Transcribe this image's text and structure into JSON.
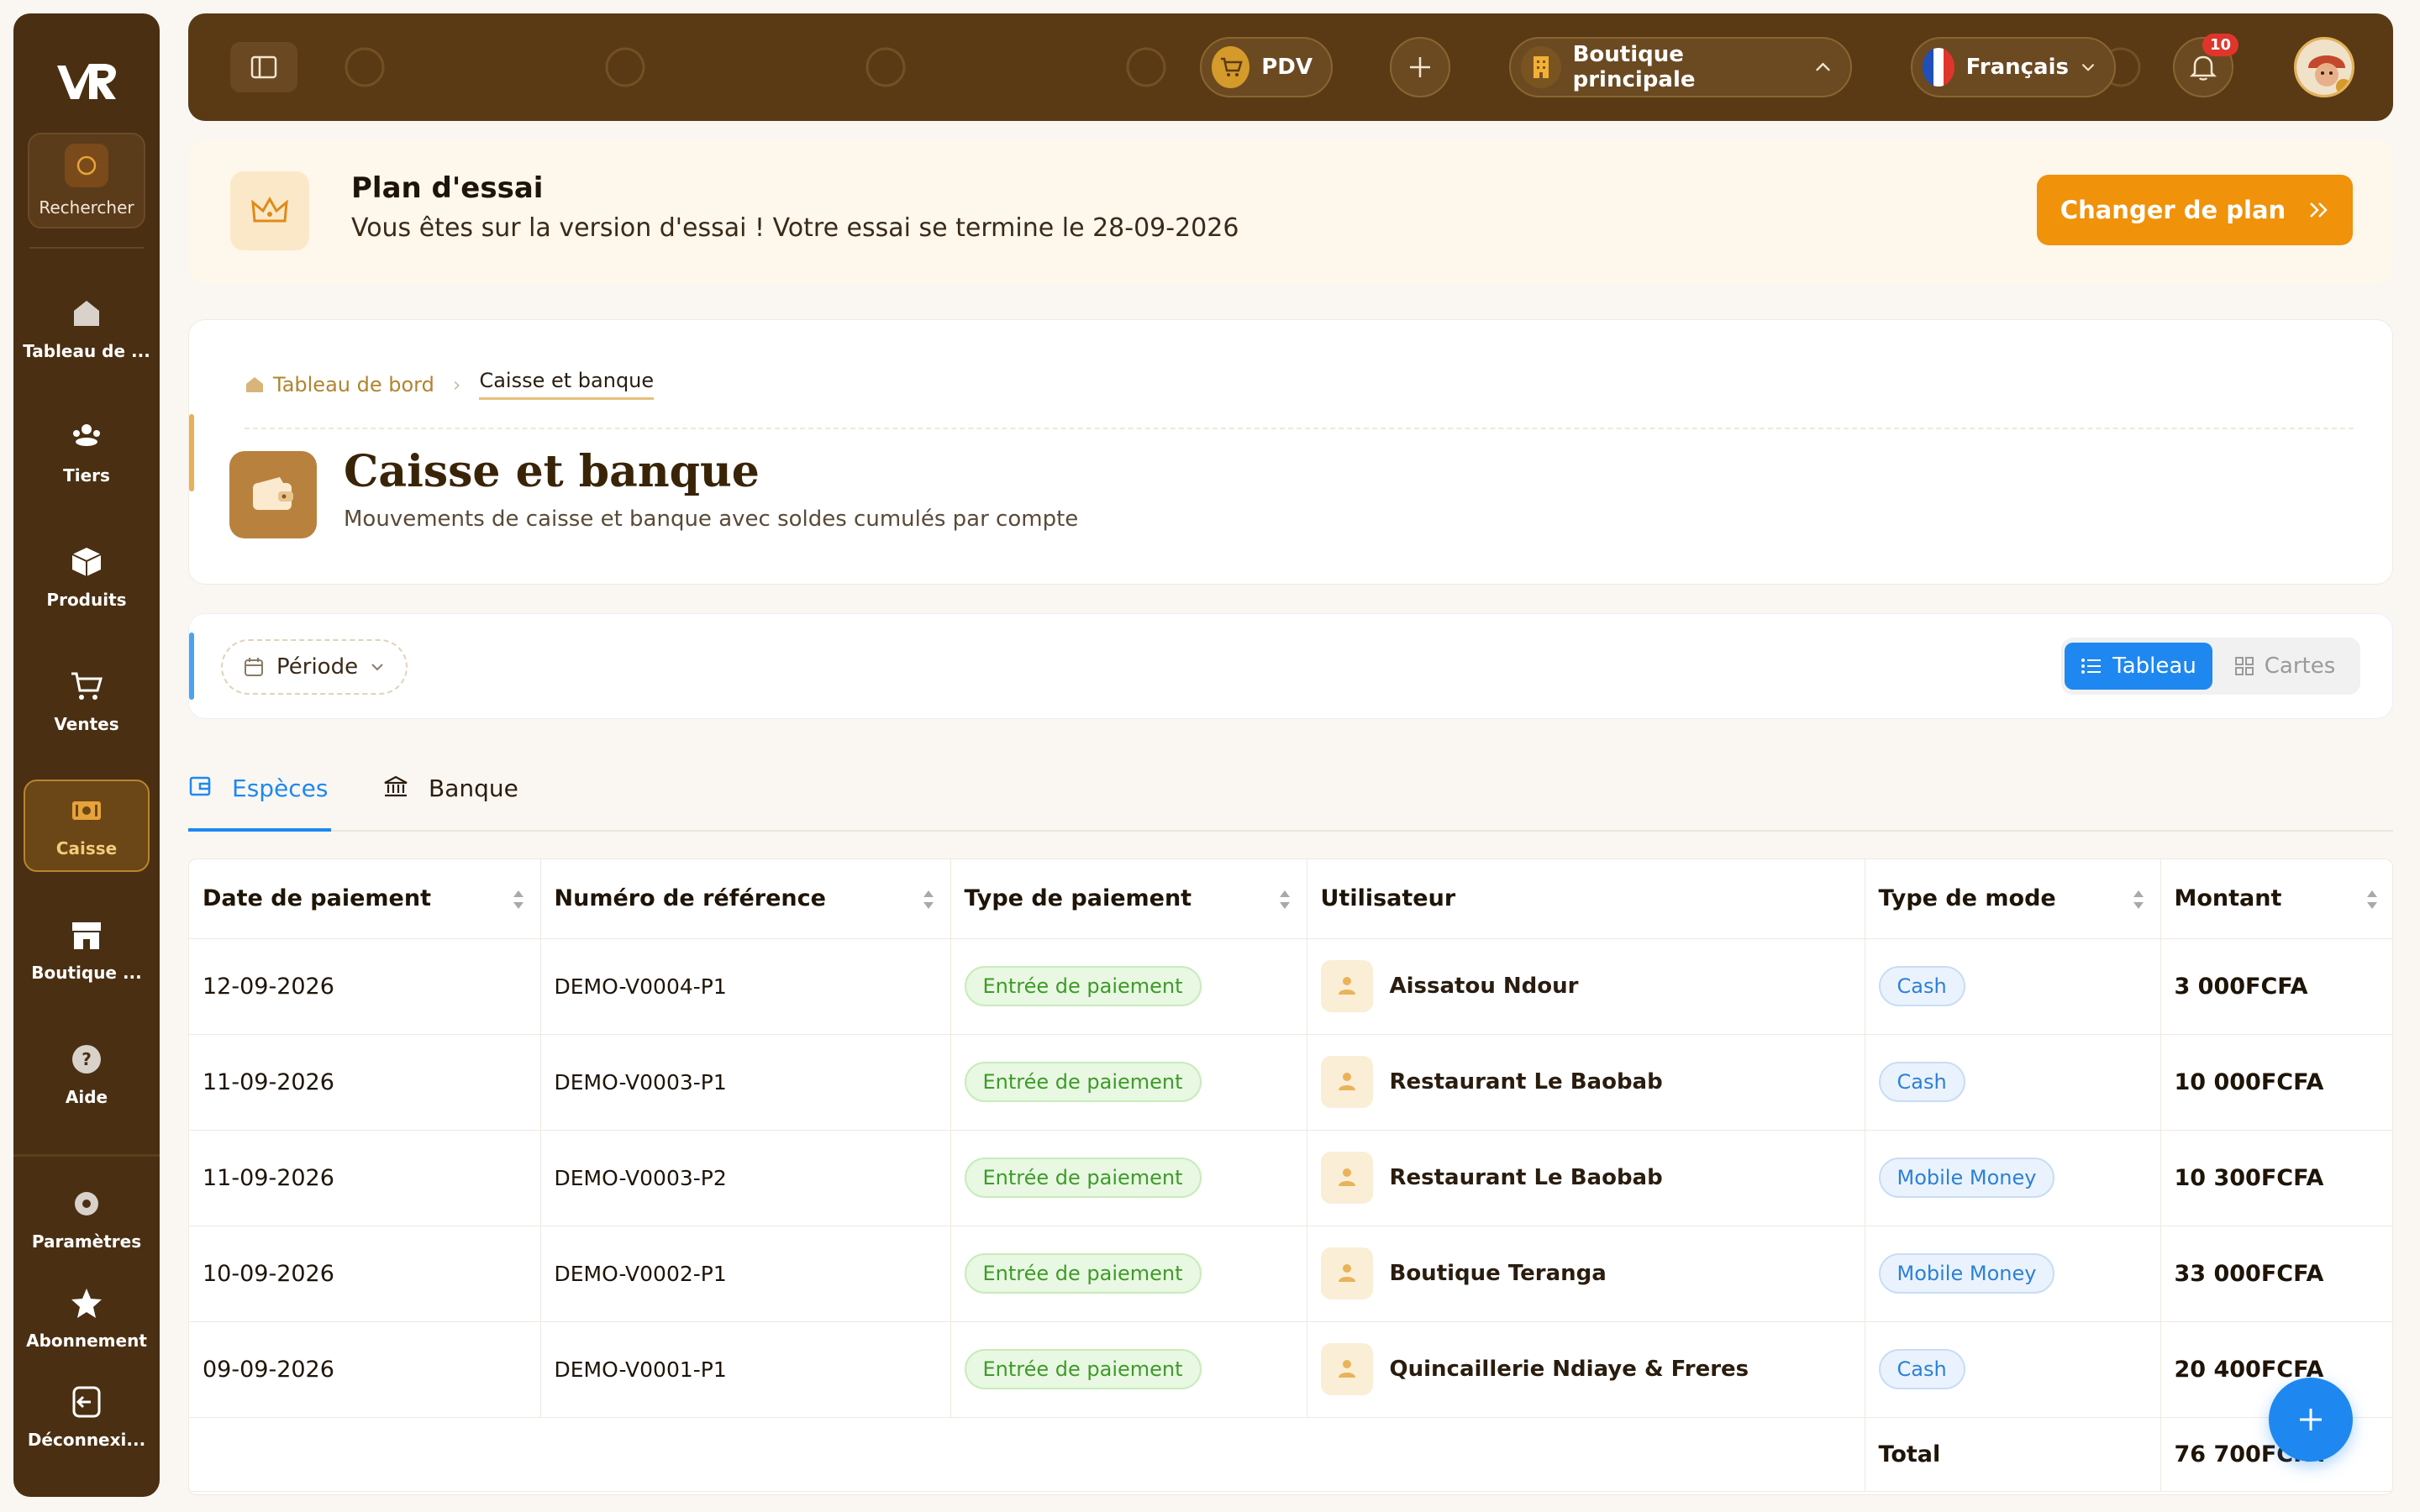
{
  "sidebar": {
    "search_label": "Rechercher",
    "items": [
      {
        "label": "Tableau de ...",
        "icon": "home-icon"
      },
      {
        "label": "Tiers",
        "icon": "users-icon"
      },
      {
        "label": "Produits",
        "icon": "box-icon"
      },
      {
        "label": "Ventes",
        "icon": "cart-icon"
      },
      {
        "label": "Caisse",
        "icon": "cash-icon",
        "active": true
      },
      {
        "label": "Boutique ...",
        "icon": "store-icon"
      },
      {
        "label": "Aide",
        "icon": "help-icon"
      }
    ],
    "bottom_items": [
      {
        "label": "Paramètres",
        "icon": "gear-icon"
      },
      {
        "label": "Abonnement",
        "icon": "star-icon"
      },
      {
        "label": "Déconnexi...",
        "icon": "logout-icon"
      }
    ]
  },
  "header": {
    "pdv_label": "PDV",
    "store_label": "Boutique principale",
    "language_label": "Français",
    "notifications_count": "10"
  },
  "trial": {
    "title": "Plan d'essai",
    "message": "Vous êtes sur la version d'essai ! Votre essai se termine le 28-09-2026",
    "cta_label": "Changer de plan"
  },
  "breadcrumb": {
    "home": "Tableau de bord",
    "current": "Caisse et banque"
  },
  "page": {
    "title": "Caisse et banque",
    "subtitle": "Mouvements de caisse et banque avec soldes cumulés par compte"
  },
  "filters": {
    "period_label": "Période",
    "view_table": "Tableau",
    "view_cards": "Cartes"
  },
  "tabs": {
    "cash": "Espèces",
    "bank": "Banque"
  },
  "table": {
    "columns": [
      "Date de paiement",
      "Numéro de référence",
      "Type de paiement",
      "Utilisateur",
      "Type de mode",
      "Montant"
    ],
    "rows": [
      {
        "date": "12-09-2026",
        "ref": "DEMO-V0004-P1",
        "type": "Entrée de paiement",
        "user": "Aissatou Ndour",
        "mode": "Cash",
        "amount": "3 000FCFA"
      },
      {
        "date": "11-09-2026",
        "ref": "DEMO-V0003-P1",
        "type": "Entrée de paiement",
        "user": "Restaurant Le Baobab",
        "mode": "Cash",
        "amount": "10 000FCFA"
      },
      {
        "date": "11-09-2026",
        "ref": "DEMO-V0003-P2",
        "type": "Entrée de paiement",
        "user": "Restaurant Le Baobab",
        "mode": "Mobile Money",
        "amount": "10 300FCFA"
      },
      {
        "date": "10-09-2026",
        "ref": "DEMO-V0002-P1",
        "type": "Entrée de paiement",
        "user": "Boutique Teranga",
        "mode": "Mobile Money",
        "amount": "33 000FCFA"
      },
      {
        "date": "09-09-2026",
        "ref": "DEMO-V0001-P1",
        "type": "Entrée de paiement",
        "user": "Quincaillerie Ndiaye & Freres",
        "mode": "Cash",
        "amount": "20 400FCFA"
      }
    ],
    "total_label": "Total",
    "total_value": "76 700FCFA"
  },
  "colors": {
    "brand_dark": "#4a2f12",
    "accent_orange": "#f0920a",
    "primary_blue": "#1e88f0"
  }
}
